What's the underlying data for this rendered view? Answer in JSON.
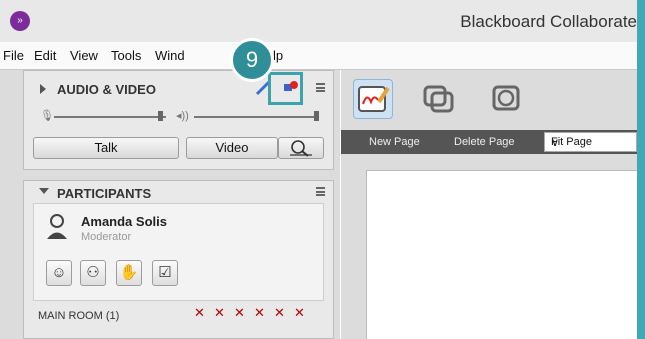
{
  "window": {
    "title": "Blackboard Collaborate"
  },
  "menubar": {
    "items": [
      {
        "label": "File"
      },
      {
        "label": "Edit"
      },
      {
        "label": "View"
      },
      {
        "label": "Tools"
      },
      {
        "label": "Wind"
      },
      {
        "label": "lp"
      }
    ]
  },
  "callout": {
    "number": "9"
  },
  "audio_video": {
    "title": "AUDIO & VIDEO",
    "talk_label": "Talk",
    "video_label": "Video"
  },
  "participants": {
    "title": "PARTICIPANTS",
    "user": {
      "name": "Amanda Solis",
      "role": "Moderator"
    },
    "room_label": "MAIN ROOM",
    "room_count": "(1)"
  },
  "workspace": {
    "new_page_label": "New Page",
    "delete_page_label": "Delete Page",
    "fit_select": "Fit Page"
  },
  "colors": {
    "accent": "#3fa9b5",
    "logo": "#7b2c9a"
  }
}
